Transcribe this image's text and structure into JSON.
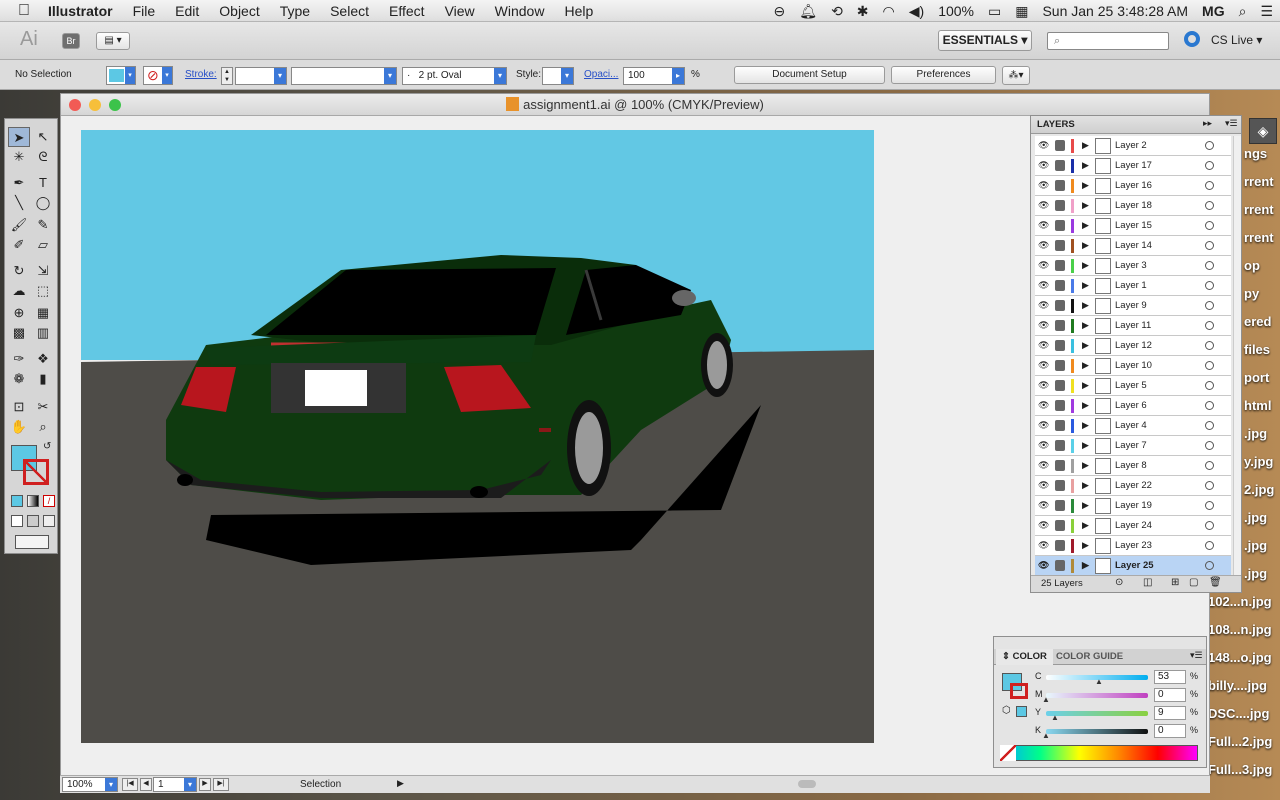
{
  "menubar": {
    "apple": "",
    "app": "Illustrator",
    "items": [
      "File",
      "Edit",
      "Object",
      "Type",
      "Select",
      "Effect",
      "View",
      "Window",
      "Help"
    ],
    "battery": "100%",
    "datetime": "Sun Jan 25  3:48:28 AM",
    "user": "MG"
  },
  "appbar": {
    "logo": "Ai",
    "bridge": "Br",
    "workspace": "ESSENTIALS",
    "cslive": "CS Live"
  },
  "control": {
    "selection": "No Selection",
    "stroke_label": "Stroke:",
    "brush": "2 pt. Oval",
    "style_label": "Style:",
    "opacity_label": "Opaci...",
    "opacity": "100",
    "percent": "%",
    "doc_setup": "Document Setup",
    "preferences": "Preferences"
  },
  "document": {
    "title": "assignment1.ai @ 100% (CMYK/Preview)"
  },
  "layers": {
    "tab": "LAYERS",
    "count": "25 Layers",
    "items": [
      {
        "name": "Layer 2",
        "color": "#e84a4a"
      },
      {
        "name": "Layer 17",
        "color": "#1a2fa8"
      },
      {
        "name": "Layer 16",
        "color": "#f08a1e"
      },
      {
        "name": "Layer 18",
        "color": "#f0a0c8"
      },
      {
        "name": "Layer 15",
        "color": "#9a3ae0"
      },
      {
        "name": "Layer 14",
        "color": "#a05020"
      },
      {
        "name": "Layer 3",
        "color": "#4ad04a"
      },
      {
        "name": "Layer 1",
        "color": "#4a7ae8"
      },
      {
        "name": "Layer 9",
        "color": "#111111"
      },
      {
        "name": "Layer 11",
        "color": "#1f7a1f"
      },
      {
        "name": "Layer 12",
        "color": "#3ac0e0"
      },
      {
        "name": "Layer 10",
        "color": "#f08a1e"
      },
      {
        "name": "Layer 5",
        "color": "#f0e020"
      },
      {
        "name": "Layer 6",
        "color": "#a03ae0"
      },
      {
        "name": "Layer 4",
        "color": "#2a5ae0"
      },
      {
        "name": "Layer 7",
        "color": "#5ad0e8"
      },
      {
        "name": "Layer 8",
        "color": "#a0a0a0"
      },
      {
        "name": "Layer 22",
        "color": "#e8a0a0"
      },
      {
        "name": "Layer 19",
        "color": "#2a8a3a"
      },
      {
        "name": "Layer 24",
        "color": "#8ad03a"
      },
      {
        "name": "Layer 23",
        "color": "#a01a2a"
      },
      {
        "name": "Layer 25",
        "color": "#b08a3a"
      }
    ]
  },
  "color_panel": {
    "tab1": "COLOR",
    "tab2": "COLOR GUIDE",
    "channels": [
      {
        "label": "C",
        "value": "53",
        "pct": 53
      },
      {
        "label": "M",
        "value": "0",
        "pct": 0
      },
      {
        "label": "Y",
        "value": "9",
        "pct": 9
      },
      {
        "label": "K",
        "value": "0",
        "pct": 0
      }
    ],
    "percent": "%"
  },
  "footer": {
    "zoom": "100%",
    "page": "1",
    "status": "Selection"
  },
  "desktop": {
    "files": [
      "ngs",
      "rrent",
      "rrent",
      "rrent",
      "op",
      "py",
      "ered",
      "files",
      "port",
      "html",
      ".jpg",
      "y.jpg",
      "2.jpg",
      ".jpg",
      ".jpg",
      ".jpg",
      "102...n.jpg",
      "108...n.jpg",
      "148...o.jpg",
      "billy....jpg",
      "DSC....jpg",
      "Full...2.jpg",
      "Full...3.jpg"
    ]
  }
}
